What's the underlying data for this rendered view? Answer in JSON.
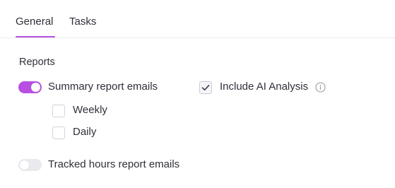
{
  "tabs": [
    {
      "label": "General",
      "active": true
    },
    {
      "label": "Tasks",
      "active": false
    }
  ],
  "accent_color": "#b84fe2",
  "reports": {
    "title": "Reports",
    "summary": {
      "label": "Summary report emails",
      "enabled": true
    },
    "include_ai": {
      "label": "Include AI Analysis",
      "checked": true,
      "info_icon": "info-icon"
    },
    "weekly": {
      "label": "Weekly",
      "checked": false
    },
    "daily": {
      "label": "Daily",
      "checked": false
    },
    "tracked": {
      "label": "Tracked hours report emails",
      "enabled": false
    }
  }
}
